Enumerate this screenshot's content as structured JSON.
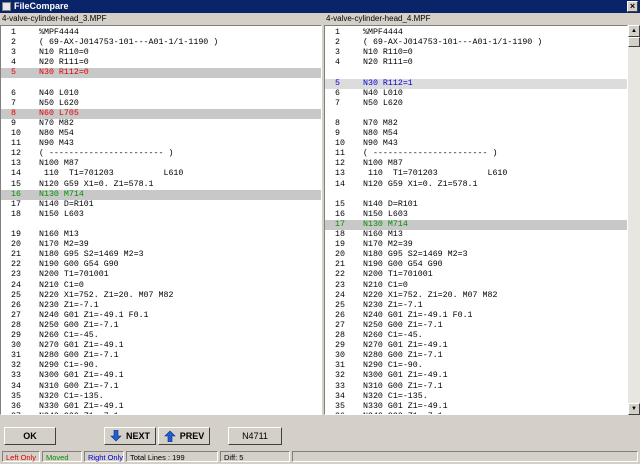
{
  "window": {
    "title": "FileCompare",
    "close_glyph": "×"
  },
  "left": {
    "title": "4-valve-cylinder-head_3.MPF",
    "lines": [
      {
        "n": "1",
        "t": "%MPF4444",
        "s": ""
      },
      {
        "n": "2",
        "t": "( 69-AX-J014753-101---A01-1/1-1190 )",
        "s": ""
      },
      {
        "n": "3",
        "t": "N10 R110=0",
        "s": ""
      },
      {
        "n": "4",
        "t": "N20 R111=0",
        "s": ""
      },
      {
        "n": "5",
        "t": "N30 R112=0",
        "s": "hl-red"
      },
      {
        "n": "",
        "t": "",
        "s": ""
      },
      {
        "n": "6",
        "t": "N40 L010",
        "s": ""
      },
      {
        "n": "7",
        "t": "N50 L620",
        "s": ""
      },
      {
        "n": "8",
        "t": "N60 L705",
        "s": "hl-red"
      },
      {
        "n": "9",
        "t": "N70 M82",
        "s": ""
      },
      {
        "n": "10",
        "t": "N80 M54",
        "s": ""
      },
      {
        "n": "11",
        "t": "N90 M43",
        "s": ""
      },
      {
        "n": "12",
        "t": "( ----------------------- )",
        "s": ""
      },
      {
        "n": "13",
        "t": "N100 M87",
        "s": ""
      },
      {
        "n": "14",
        "t": " 110  T1=701203          L610",
        "s": ""
      },
      {
        "n": "15",
        "t": "N120 G59 X1=0. Z1=578.1",
        "s": ""
      },
      {
        "n": "16",
        "t": "N130 M714",
        "s": "hl-green"
      },
      {
        "n": "17",
        "t": "N140 D=R101",
        "s": ""
      },
      {
        "n": "18",
        "t": "N150 L603",
        "s": ""
      },
      {
        "n": "",
        "t": "",
        "s": ""
      },
      {
        "n": "19",
        "t": "N160 M13",
        "s": ""
      },
      {
        "n": "20",
        "t": "N170 M2=39",
        "s": ""
      },
      {
        "n": "21",
        "t": "N180 G95 S2=1469 M2=3",
        "s": ""
      },
      {
        "n": "22",
        "t": "N190 G00 G54 G90",
        "s": ""
      },
      {
        "n": "23",
        "t": "N200 T1=701001",
        "s": ""
      },
      {
        "n": "24",
        "t": "N210 C1=0",
        "s": ""
      },
      {
        "n": "25",
        "t": "N220 X1=752. Z1=20. M07 M82",
        "s": ""
      },
      {
        "n": "26",
        "t": "N230 Z1=-7.1",
        "s": ""
      },
      {
        "n": "27",
        "t": "N240 G01 Z1=-49.1 F0.1",
        "s": ""
      },
      {
        "n": "28",
        "t": "N250 G00 Z1=-7.1",
        "s": ""
      },
      {
        "n": "29",
        "t": "N260 C1=-45.",
        "s": ""
      },
      {
        "n": "30",
        "t": "N270 G01 Z1=-49.1",
        "s": ""
      },
      {
        "n": "31",
        "t": "N280 G00 Z1=-7.1",
        "s": ""
      },
      {
        "n": "32",
        "t": "N290 C1=-90.",
        "s": ""
      },
      {
        "n": "33",
        "t": "N300 G01 Z1=-49.1",
        "s": ""
      },
      {
        "n": "34",
        "t": "N310 G00 Z1=-7.1",
        "s": ""
      },
      {
        "n": "35",
        "t": "N320 C1=-135.",
        "s": ""
      },
      {
        "n": "36",
        "t": "N330 G01 Z1=-49.1",
        "s": ""
      },
      {
        "n": "37",
        "t": "N340 G00 Z1=-7.1",
        "s": ""
      },
      {
        "n": "38",
        "t": "N350 C1=-180.",
        "s": ""
      },
      {
        "n": "39",
        "t": "N360 G01 Z1=-49.1",
        "s": ""
      }
    ]
  },
  "right": {
    "title": "4-valve-cylinder-head_4.MPF",
    "lines": [
      {
        "n": "1",
        "t": "%MPF4444",
        "s": ""
      },
      {
        "n": "2",
        "t": "( 69-AX-J014753-101---A01-1/1-1190 )",
        "s": ""
      },
      {
        "n": "3",
        "t": "N10 R110=0",
        "s": ""
      },
      {
        "n": "4",
        "t": "N20 R111=0",
        "s": ""
      },
      {
        "n": "",
        "t": "",
        "s": ""
      },
      {
        "n": "5",
        "t": "N30 R112=1",
        "s": "hl-blue"
      },
      {
        "n": "6",
        "t": "N40 L010",
        "s": ""
      },
      {
        "n": "7",
        "t": "N50 L620",
        "s": ""
      },
      {
        "n": "",
        "t": "",
        "s": ""
      },
      {
        "n": "8",
        "t": "N70 M82",
        "s": ""
      },
      {
        "n": "9",
        "t": "N80 M54",
        "s": ""
      },
      {
        "n": "10",
        "t": "N90 M43",
        "s": ""
      },
      {
        "n": "11",
        "t": "( ----------------------- )",
        "s": ""
      },
      {
        "n": "12",
        "t": "N100 M87",
        "s": ""
      },
      {
        "n": "13",
        "t": " 110  T1=701203          L610",
        "s": ""
      },
      {
        "n": "14",
        "t": "N120 G59 X1=0. Z1=578.1",
        "s": ""
      },
      {
        "n": "",
        "t": "",
        "s": ""
      },
      {
        "n": "15",
        "t": "N140 D=R101",
        "s": ""
      },
      {
        "n": "16",
        "t": "N150 L603",
        "s": ""
      },
      {
        "n": "17",
        "t": "N130 M714",
        "s": "hl-green"
      },
      {
        "n": "18",
        "t": "N160 M13",
        "s": ""
      },
      {
        "n": "19",
        "t": "N170 M2=39",
        "s": ""
      },
      {
        "n": "20",
        "t": "N180 G95 S2=1469 M2=3",
        "s": ""
      },
      {
        "n": "21",
        "t": "N190 G00 G54 G90",
        "s": ""
      },
      {
        "n": "22",
        "t": "N200 T1=701001",
        "s": ""
      },
      {
        "n": "23",
        "t": "N210 C1=0",
        "s": ""
      },
      {
        "n": "24",
        "t": "N220 X1=752. Z1=20. M07 M82",
        "s": ""
      },
      {
        "n": "25",
        "t": "N230 Z1=-7.1",
        "s": ""
      },
      {
        "n": "26",
        "t": "N240 G01 Z1=-49.1 F0.1",
        "s": ""
      },
      {
        "n": "27",
        "t": "N250 G00 Z1=-7.1",
        "s": ""
      },
      {
        "n": "28",
        "t": "N260 C1=-45.",
        "s": ""
      },
      {
        "n": "29",
        "t": "N270 G01 Z1=-49.1",
        "s": ""
      },
      {
        "n": "30",
        "t": "N280 G00 Z1=-7.1",
        "s": ""
      },
      {
        "n": "31",
        "t": "N290 C1=-90.",
        "s": ""
      },
      {
        "n": "32",
        "t": "N300 G01 Z1=-49.1",
        "s": ""
      },
      {
        "n": "33",
        "t": "N310 G00 Z1=-7.1",
        "s": ""
      },
      {
        "n": "34",
        "t": "N320 C1=-135.",
        "s": ""
      },
      {
        "n": "35",
        "t": "N330 G01 Z1=-49.1",
        "s": ""
      },
      {
        "n": "36",
        "t": "N340 G00 Z1=-7.1",
        "s": ""
      },
      {
        "n": "37",
        "t": "N350 C1=-180.",
        "s": ""
      },
      {
        "n": "38",
        "t": "N360 G01 Z1=-49.1",
        "s": ""
      }
    ]
  },
  "scrollbar_glyphs": {
    "up": "▲",
    "down": "▼"
  },
  "buttons": {
    "ok": "OK",
    "next": "NEXT",
    "prev": "PREV",
    "goto": "N4711"
  },
  "status": {
    "left_only": "Left Only",
    "moved": "Moved",
    "right_only": "Right Only",
    "total_lines": "Total Lines : 199",
    "diff": "Diff: 5"
  },
  "colors": {
    "left_only": "#e00000",
    "moved": "#009000",
    "right_only": "#0000d0",
    "arrow": "#1f5fd0",
    "title_bg": "#0a246a"
  }
}
